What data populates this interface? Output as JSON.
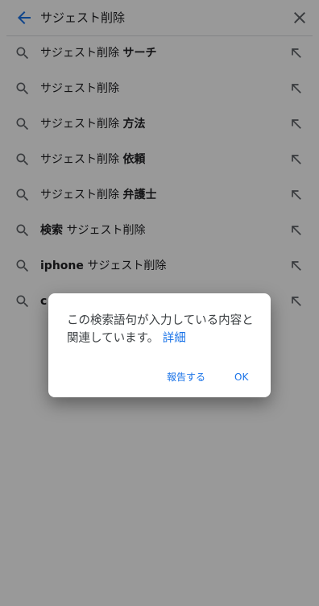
{
  "search_bar": {
    "query": "サジェスト削除",
    "back_icon": "arrow-back-icon",
    "clear_icon": "close-icon"
  },
  "suggestions": [
    {
      "prefix": "サジェスト削除 ",
      "bold": "サーチ",
      "suffix": ""
    },
    {
      "prefix": "サジェスト削除",
      "bold": "",
      "suffix": ""
    },
    {
      "prefix": "サジェスト削除 ",
      "bold": "方法",
      "suffix": ""
    },
    {
      "prefix": "サジェスト削除 ",
      "bold": "依頼",
      "suffix": ""
    },
    {
      "prefix": "サジェスト削除 ",
      "bold": "弁護士",
      "suffix": ""
    },
    {
      "prefix": "",
      "bold": "検索",
      "suffix": " サジェスト削除"
    },
    {
      "prefix": "",
      "bold": "iphone",
      "suffix": " サジェスト削除"
    },
    {
      "prefix": "",
      "bold": "c",
      "suffix": ""
    }
  ],
  "dialog": {
    "message": "この検索語句が入力している内容と関連しています。",
    "link": "詳細",
    "report_button": "報告する",
    "ok_button": "OK"
  },
  "colors": {
    "accent": "#1a73e8",
    "icon": "#5f6368",
    "scrim": "rgba(0,0,0,0.40)"
  }
}
